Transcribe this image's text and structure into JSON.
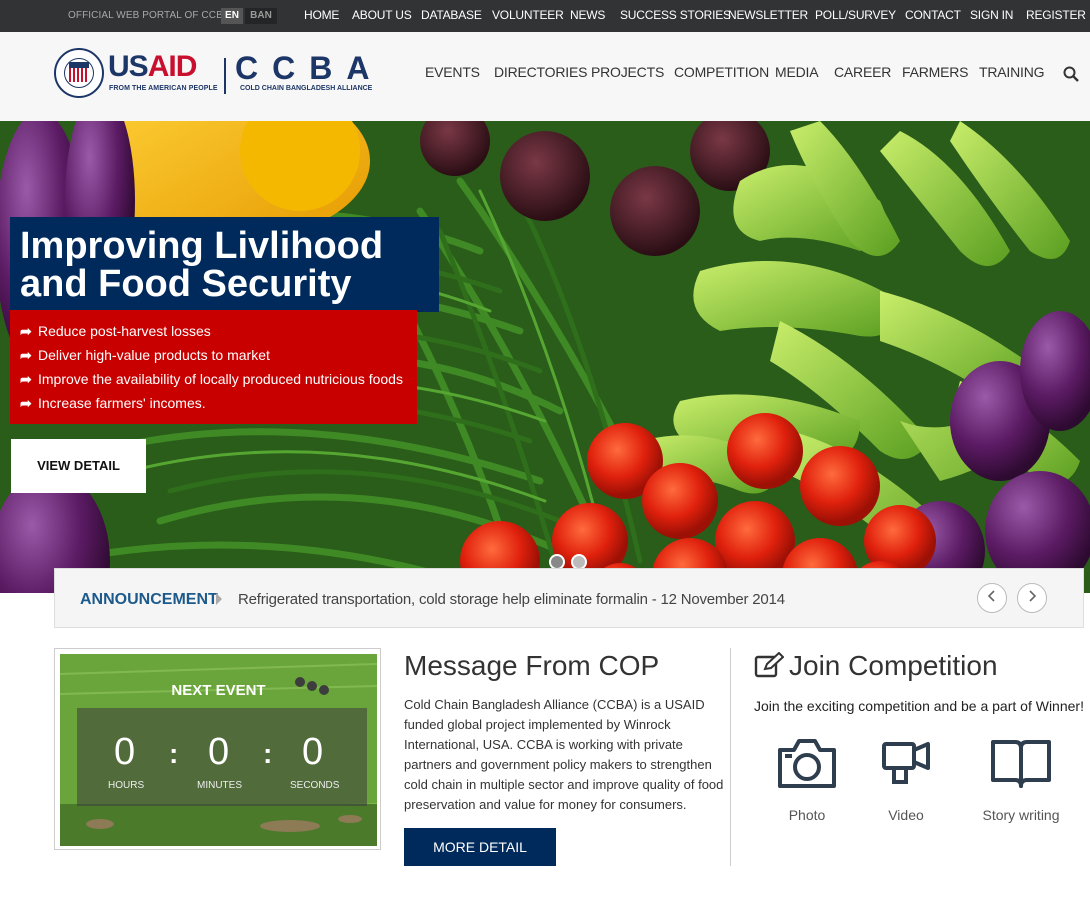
{
  "topbar": {
    "official": "OFFICIAL WEB PORTAL OF CCBA",
    "lang_en": "EN",
    "lang_ban": "BAN",
    "links": [
      "HOME",
      "ABOUT US",
      "DATABASE",
      "VOLUNTEER",
      "NEWS",
      "SUCCESS STORIES",
      "NEWSLETTER",
      "POLL/SURVEY",
      "CONTACT",
      "SIGN IN",
      "REGISTER"
    ]
  },
  "logo": {
    "usaid_us": "US",
    "usaid_aid": "AID",
    "usaid_sub": "FROM THE AMERICAN PEOPLE",
    "ccba": "CCBA",
    "ccba_sub": "COLD CHAIN BANGLADESH ALLIANCE"
  },
  "nav": [
    "EVENTS",
    "DIRECTORIES",
    "PROJECTS",
    "COMPETITION",
    "MEDIA",
    "CAREER",
    "FARMERS",
    "TRAINING"
  ],
  "hero": {
    "title_line1": "Improving Livlihood",
    "title_line2": "and Food Security",
    "bullets": [
      "Reduce post-harvest losses",
      "Deliver high-value products to market",
      "Improve the availability of locally produced nutricious foods",
      "Increase farmers' incomes."
    ],
    "button": "VIEW DETAIL"
  },
  "announcement": {
    "label": "ANNOUNCEMENT",
    "text": "Refrigerated transportation, cold storage help eliminate formalin - 12 November 2014"
  },
  "event": {
    "title": "NEXT EVENT",
    "hours": "0",
    "minutes": "0",
    "seconds": "0",
    "hours_label": "HOURS",
    "minutes_label": "MINUTES",
    "seconds_label": "SECONDS"
  },
  "cop": {
    "title": "Message From COP",
    "text": "Cold Chain Bangladesh Alliance (CCBA) is a USAID funded global project  implemented by Winrock International, USA. CCBA is working with private partners and government policy makers to strengthen cold chain in multiple sector and improve quality of food preservation and value for money for consumers.",
    "button": "MORE DETAIL"
  },
  "competition": {
    "title": "Join Competition",
    "text": "Join the exciting competition and be a part of Winner!",
    "items": [
      {
        "label": "Photo",
        "icon": "camera-icon"
      },
      {
        "label": "Video",
        "icon": "video-camera-icon"
      },
      {
        "label": "Story writing",
        "icon": "book-icon"
      }
    ]
  },
  "colors": {
    "navy": "#002a5c",
    "red": "#c90000",
    "topbar": "#313335"
  }
}
